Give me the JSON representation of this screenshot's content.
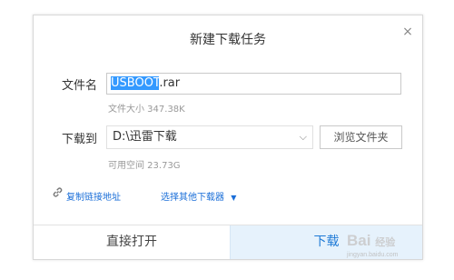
{
  "dialog": {
    "title": "新建下载任务",
    "close_icon": "×"
  },
  "file": {
    "label": "文件名",
    "name_selected": "USBOOT",
    "name_ext": ".rar",
    "size_text": "文件大小 347.38K"
  },
  "download_to": {
    "label": "下载到",
    "path": "D:\\迅雷下载",
    "chevron": "⌵",
    "browse_label": "浏览文件夹",
    "space_text": "可用空间 23.73G"
  },
  "links": {
    "copy_link": "复制链接地址",
    "choose_other": "选择其他下载器",
    "choose_other_arrow": "▼"
  },
  "footer": {
    "open_label": "直接打开",
    "download_label": "下载"
  },
  "watermark": {
    "text": "Bai",
    "text2": "经验",
    "sub": "jingyan.baidu.com"
  },
  "colors": {
    "accent": "#1f7ad6",
    "selection": "#3399ff",
    "download_bg": "#e6f2fc"
  }
}
